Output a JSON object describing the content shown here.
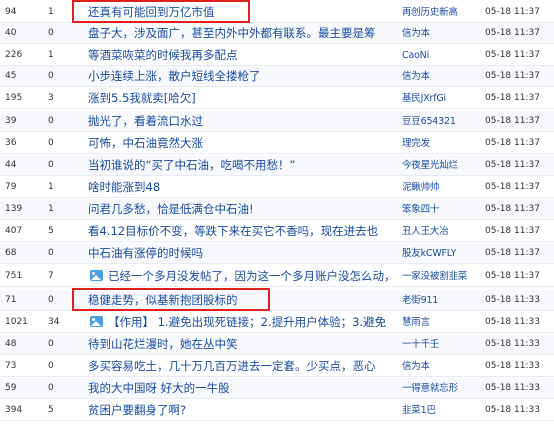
{
  "posts": [
    {
      "views": "94",
      "replies": "1",
      "title": "还真有可能回到万亿市值",
      "author": "再创历史新高",
      "time": "05-18 11:37",
      "has_image": false,
      "highlighted": true
    },
    {
      "views": "40",
      "replies": "0",
      "title": "盘子大，涉及面广，甚至内外中外都有联系。最主要是筹",
      "author": "信为本",
      "time": "05-18 11:37",
      "has_image": false,
      "highlighted": false
    },
    {
      "views": "226",
      "replies": "1",
      "title": "等酒菜咴菜的时候我再多配点",
      "author": "CaoNi",
      "time": "05-18 11:37",
      "has_image": false,
      "highlighted": false
    },
    {
      "views": "45",
      "replies": "0",
      "title": "小步连续上涨，散户短线全搂枪了",
      "author": "信为本",
      "time": "05-18 11:37",
      "has_image": false,
      "highlighted": false
    },
    {
      "views": "195",
      "replies": "3",
      "title": "涨到5.5我就卖[哈欠]",
      "author": "基民JXrfGi",
      "time": "05-18 11:37",
      "has_image": false,
      "highlighted": false
    },
    {
      "views": "39",
      "replies": "0",
      "title": "抛光了，看着流口水过",
      "author": "豆豆654321",
      "time": "05-18 11:37",
      "has_image": false,
      "highlighted": false
    },
    {
      "views": "36",
      "replies": "0",
      "title": "可怖，中石油竟然大涨",
      "author": "理完发",
      "time": "05-18 11:37",
      "has_image": false,
      "highlighted": false
    },
    {
      "views": "44",
      "replies": "0",
      "title": "当初谁说的“买了中石油，吃喝不用愁！”",
      "author": "今夜星光灿烂",
      "time": "05-18 11:37",
      "has_image": false,
      "highlighted": false
    },
    {
      "views": "79",
      "replies": "1",
      "title": "啥时能涨到48",
      "author": "泥鳅帅帅",
      "time": "05-18 11:37",
      "has_image": false,
      "highlighted": false
    },
    {
      "views": "139",
      "replies": "1",
      "title": "问君几多愁，恰是低满仓中石油!",
      "author": "笨象四十",
      "time": "05-18 11:37",
      "has_image": false,
      "highlighted": false
    },
    {
      "views": "407",
      "replies": "5",
      "title": "看4.12目标价不变，等跌下来在买它不香吗，现在进去也",
      "author": "丑人王大冶",
      "time": "05-18 11:37",
      "has_image": false,
      "highlighted": false
    },
    {
      "views": "68",
      "replies": "0",
      "title": "中石油有涨停的时候吗",
      "author": "股友kCWFLY",
      "time": "05-18 11:37",
      "has_image": false,
      "highlighted": false
    },
    {
      "views": "751",
      "replies": "7",
      "title": "已经一个多月没发帖了，因为这一个多月账户没怎么动，",
      "author": "一家没被割韭菜",
      "time": "05-18 11:37",
      "has_image": true,
      "highlighted": false
    },
    {
      "views": "71",
      "replies": "0",
      "title": "稳健走势，似基新抱团股标的",
      "author": "老街911",
      "time": "05-18 11:33",
      "has_image": false,
      "highlighted": true
    },
    {
      "views": "1021",
      "replies": "34",
      "title": "【作用】 1.避免出现死链接；2.提升用户体验；3.避免",
      "author": "慧雨言",
      "time": "05-18 11:33",
      "has_image": true,
      "highlighted": false
    },
    {
      "views": "48",
      "replies": "0",
      "title": "待到山花烂漫时，她在丛中笑",
      "author": "一十千壬",
      "time": "05-18 11:33",
      "has_image": false,
      "highlighted": false
    },
    {
      "views": "73",
      "replies": "0",
      "title": "多买容易吃土，几十万几百万进去一定套。少买点，恶心",
      "author": "信为本",
      "time": "05-18 11:33",
      "has_image": false,
      "highlighted": false
    },
    {
      "views": "59",
      "replies": "0",
      "title": "我的大中国呀 好大的一牛股",
      "author": "一得意就忘形",
      "time": "05-18 11:33",
      "has_image": false,
      "highlighted": false
    },
    {
      "views": "394",
      "replies": "5",
      "title": "贫困户要翻身了啊?",
      "author": "韭菜1巴",
      "time": "05-18 11:33",
      "has_image": false,
      "highlighted": false
    }
  ],
  "colors": {
    "title_link": "#1a4aa0",
    "text": "#333333",
    "highlight_border": "#e02020",
    "image_icon": "#4a9fe0"
  }
}
